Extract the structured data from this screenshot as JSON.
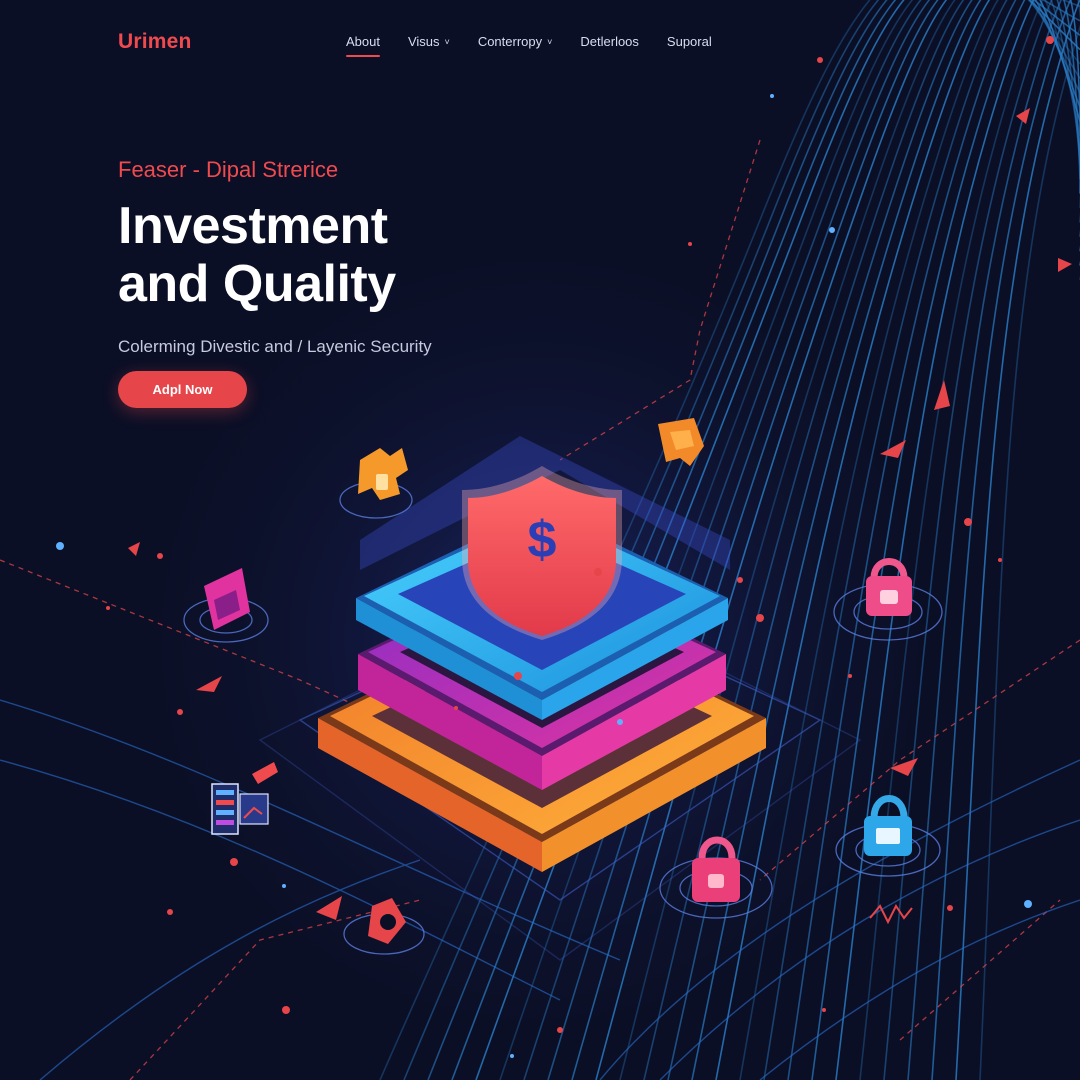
{
  "brand": {
    "name": "Urimen"
  },
  "nav": {
    "items": [
      {
        "label": "About",
        "has_dropdown": false,
        "active": true
      },
      {
        "label": "Visus",
        "has_dropdown": true,
        "active": false
      },
      {
        "label": "Conterropy",
        "has_dropdown": true,
        "active": false
      },
      {
        "label": "Detlerloos",
        "has_dropdown": false,
        "active": false
      },
      {
        "label": "Suporal",
        "has_dropdown": false,
        "active": false
      }
    ]
  },
  "hero": {
    "eyebrow": "Feaser - Dipal Strerice",
    "title_line1": "Investment",
    "title_line2": "and Quality",
    "subtitle": "Colerming Divestic and / Layenic Security",
    "cta_label": "Adpl Now"
  },
  "illustration": {
    "central_icon": "shield-dollar-icon",
    "shield_symbol": "$",
    "orbit_icons": [
      "puzzle-icon",
      "chat-bubble-icon",
      "tag-icon",
      "padlock-icon",
      "dashboard-icon",
      "padlock-icon",
      "padlock-icon",
      "refresh-icon"
    ]
  },
  "colors": {
    "background": "#0b0f26",
    "accent": "#ef4a4e",
    "lines": "#2f8fe0",
    "layer_top": "#2fb3f2",
    "layer_mid": "#b53cc4",
    "layer_bottom": "#f5a12d",
    "shield": "#ee4a55"
  }
}
